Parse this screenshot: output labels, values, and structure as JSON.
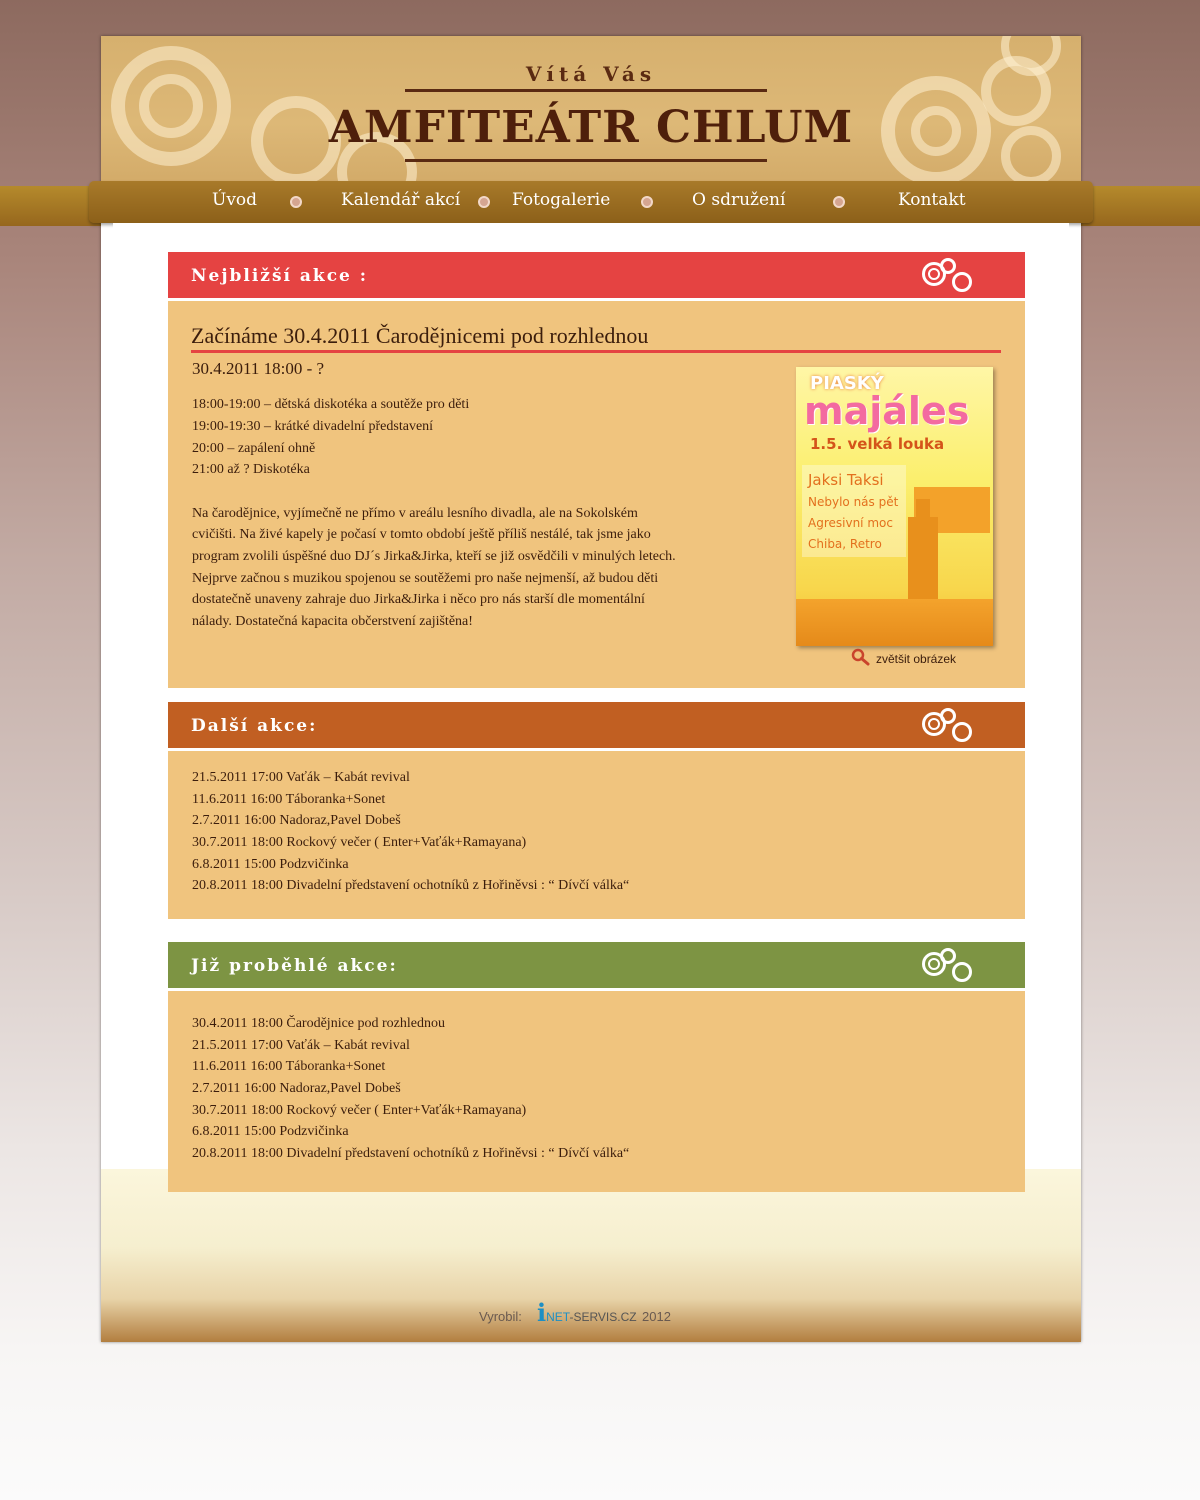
{
  "header": {
    "welcome": "Vítá Vás",
    "title": "AMFITEÁTR CHLUM"
  },
  "nav": {
    "items": [
      "Úvod",
      "Kalendář akcí",
      "Fotogalerie",
      "O sdružení",
      "Kontakt"
    ]
  },
  "nearest": {
    "heading": "Nejbližší akce :",
    "color": "#e54342",
    "event_title": "Začínáme 30.4.2011 Čarodějnicemi pod rozhlednou",
    "event_date": "30.4.2011  18:00 - ?",
    "schedule": [
      "18:00-19:00 – dětská diskotéka a soutěže pro děti",
      "19:00-19:30 – krátké divadelní představení",
      "20:00 – zapálení ohně",
      "21:00 až ? Diskotéka"
    ],
    "description": [
      "Na čarodějnice, vyjímečně ne přímo v areálu lesního divadla, ale na Sokolském",
      "cvičišti. Na živé kapely je počasí v tomto období ještě příliš nestálé, tak jsme jako",
      "program zvolili úspěšné duo DJ´s Jirka&Jirka, kteří se již osvědčili v minulých letech.",
      "Nejprve začnou s muzikou spojenou se soutěžemi pro naše nejmenší, až budou děti",
      "dostatečně unaveny zahraje duo Jirka&Jirka i něco pro nás starší dle momentální",
      "nálady. Dostatečná kapacita občerstvení zajištěna!"
    ],
    "poster": {
      "line1": "PIASKÝ",
      "line2": "majáles",
      "line3": "1.5. velká louka",
      "bands": [
        "Jaksi Taksi",
        "Nebylo nás pět",
        "Agresivní moc",
        "Chiba, Retro"
      ]
    },
    "enlarge_label": "zvětšit obrázek"
  },
  "next": {
    "heading": "Další akce:",
    "color": "#c15f22",
    "items": [
      "21.5.2011 17:00  Vaťák – Kabát revival",
      "11.6.2011 16:00  Táboranka+Sonet",
      "2.7.2011 16:00  Nadoraz,Pavel Dobeš",
      "30.7.2011 18:00  Rockový večer ( Enter+Vaťák+Ramayana)",
      "6.8.2011 15:00  Podzvičinka",
      "20.8.2011 18:00  Divadelní představení ochotníků z Hořiněvsi : “ Dívčí válka“"
    ]
  },
  "past": {
    "heading": "Již proběhlé akce:",
    "color": "#7d9443",
    "items": [
      "30.4.2011 18:00 Čarodějnice pod rozhlednou",
      "21.5.2011 17:00 Vaťák – Kabát revival",
      "11.6.2011 16:00 Táboranka+Sonet",
      "2.7.2011 16:00 Nadoraz,Pavel Dobeš",
      "30.7.2011 18:00  Rockový večer ( Enter+Vaťák+Ramayana)",
      "6.8.2011 15:00 Podzvičinka",
      "20.8.2011 18:00 Divadelní představení ochotníků z Hořiněvsi : “ Dívčí válka“"
    ]
  },
  "footer": {
    "made_by": "Vyrobil:",
    "brand_i": "i",
    "brand_net": "NET",
    "brand_rest": "-SERVIS.CZ",
    "year": "2012"
  }
}
